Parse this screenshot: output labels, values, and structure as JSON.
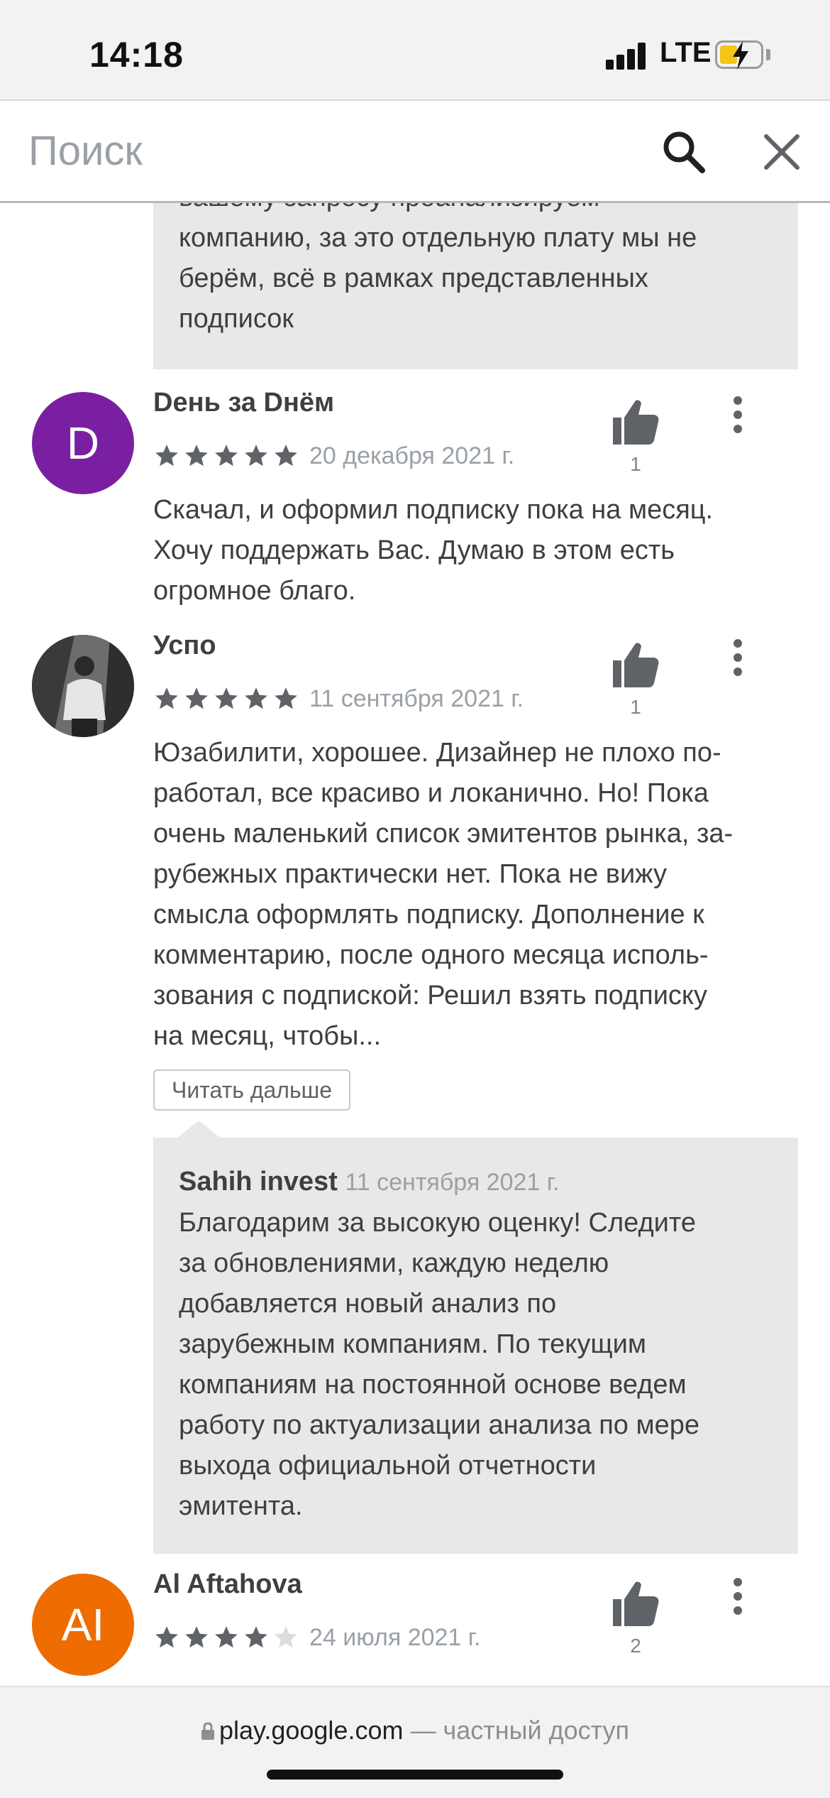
{
  "status_bar": {
    "time": "14:18",
    "network": "LTE"
  },
  "search": {
    "placeholder": "Поиск",
    "value": ""
  },
  "top_reply": {
    "lines": [
      "вашему запросу проанализируем",
      "компанию, за это отдельную плату мы не",
      "берём, всё в рамках представленных",
      "подписок"
    ]
  },
  "reviews": [
    {
      "avatar_letter": "D",
      "avatar_color": "#7b1fa2",
      "author": "Dень за Dнём",
      "rating": 5,
      "date": "20 декабря 2021 г.",
      "likes": "1",
      "lines": [
        "Скачал, и оформил подписку пока на месяц.",
        "Хочу поддержать Вас. Думаю в этом есть",
        "огромное благо."
      ]
    },
    {
      "avatar_letter": "",
      "avatar_color": "#4a4a4a",
      "author": "Успо",
      "rating": 5,
      "date": "11 сентября 2021 г.",
      "likes": "1",
      "lines": [
        "Юзабилити, хорошее. Дизайнер не плохо по-",
        "работал, все красиво и локанично. Но! Пока",
        "очень маленький список эмитентов рынка, за-",
        "рубежных практически нет. Пока не вижу",
        "смысла оформлять подписку. Дополнение к",
        "комментарию, после одного месяца исполь-",
        "зования с подпиской: Решил взять подписку",
        "на месяц, чтобы..."
      ],
      "read_more": "Читать дальше",
      "reply": {
        "author": "Sahih invest",
        "date": "11 сентября 2021 г.",
        "lines": [
          "Благодарим за высокую оценку! Следите",
          "за обновлениями, каждую неделю",
          "добавляется новый анализ по",
          "зарубежным компаниям. По текущим",
          "компаниям на постоянной основе ведем",
          "работу по актуализации анализа по мере",
          "выхода официальной отчетности",
          "эмитента."
        ]
      }
    },
    {
      "avatar_letter": "AI",
      "avatar_color": "#ef6c00",
      "author": "Al Aftahova",
      "rating": 4,
      "date": "24 июля 2021 г.",
      "likes": "2",
      "lines": []
    }
  ],
  "browser_bar": {
    "host": "play.google.com",
    "access": " — частный доступ"
  },
  "colors": {
    "star_filled": "#5f6368",
    "star_empty": "#dadce0"
  }
}
